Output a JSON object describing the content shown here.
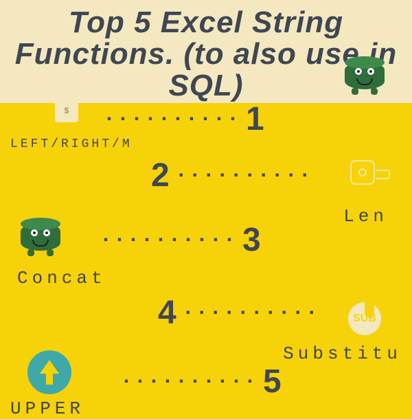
{
  "title": "Top 5 Excel String Functions. (to also use in SQL)",
  "items": [
    {
      "num": "1",
      "label": "LEFT/RIGHT/M",
      "icon": "badge"
    },
    {
      "num": "2",
      "label": "Len",
      "icon": "tape-measure"
    },
    {
      "num": "3",
      "label": "Concat",
      "icon": "database-character"
    },
    {
      "num": "4",
      "label": "Substitu",
      "icon": "sub-circle"
    },
    {
      "num": "5",
      "label": "UPPER",
      "icon": "up-arrow-circle"
    }
  ],
  "dots": "··········",
  "badge_text": "$"
}
